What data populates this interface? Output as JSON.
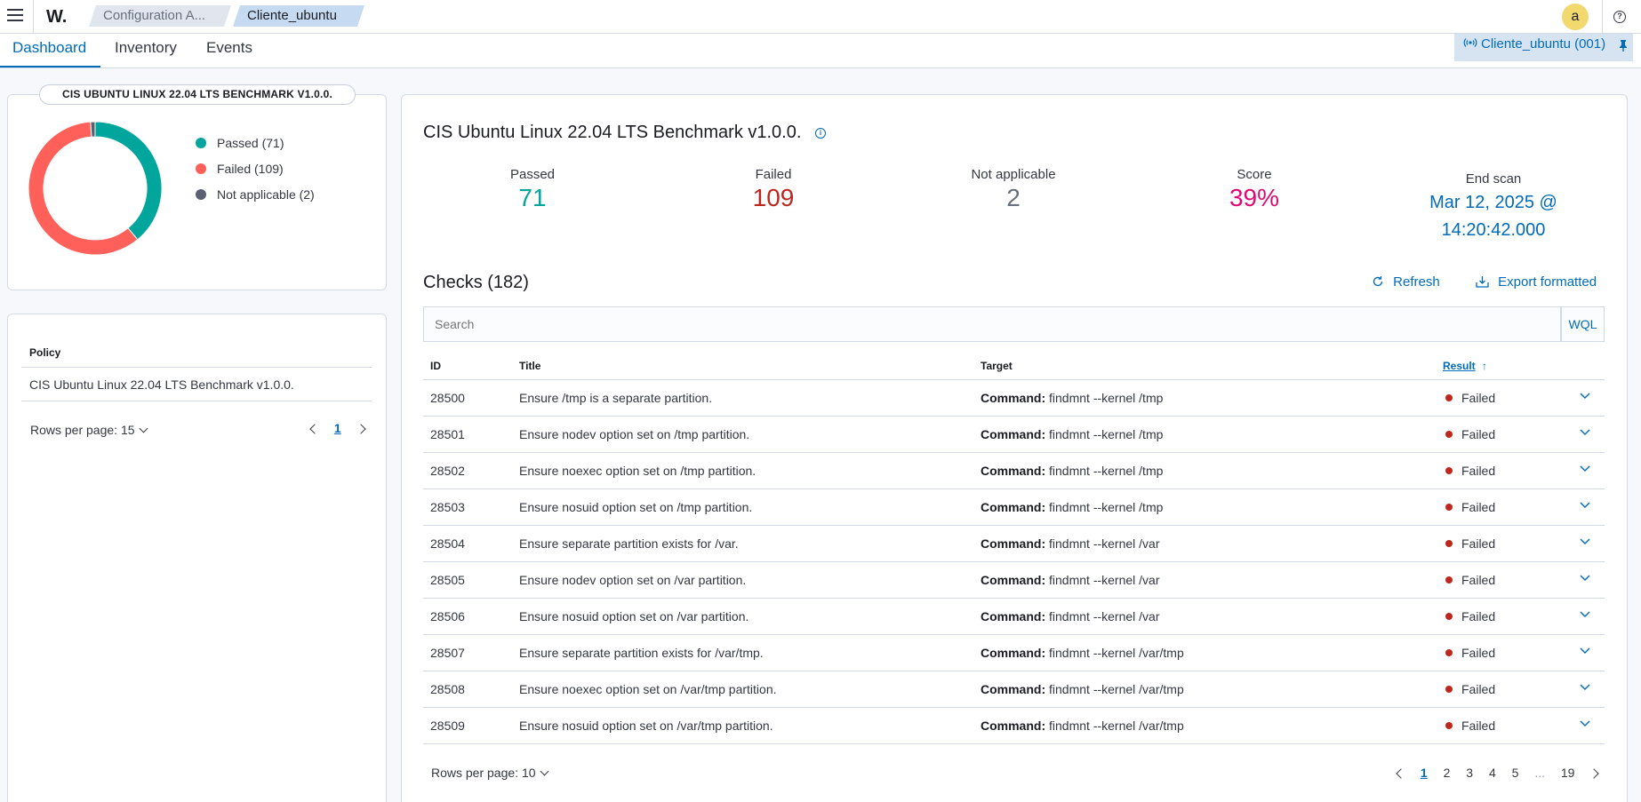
{
  "header": {
    "logo": "W.",
    "breadcrumbs": [
      "Configuration A...",
      "Cliente_ubuntu"
    ],
    "avatar": "a",
    "help": "?"
  },
  "tabs": [
    "Dashboard",
    "Inventory",
    "Events"
  ],
  "agent_pill": "Cliente_ubuntu (001)",
  "summary": {
    "badge": "CIS UBUNTU LINUX 22.04 LTS BENCHMARK V1.0.0.",
    "legend": [
      {
        "label": "Passed (71)",
        "color": "#00a69b"
      },
      {
        "label": "Failed (109)",
        "color": "#ff6059"
      },
      {
        "label": "Not applicable (2)",
        "color": "#5a6270"
      }
    ],
    "donut_values": {
      "passed": 71,
      "failed": 109,
      "not_applicable": 2
    }
  },
  "policy": {
    "header": "Policy",
    "row": "CIS Ubuntu Linux 22.04 LTS Benchmark v1.0.0.",
    "rows_per_page": "Rows per page: 15",
    "page": "1"
  },
  "main": {
    "title": "CIS Ubuntu Linux 22.04 LTS Benchmark v1.0.0.",
    "stats": {
      "passed_label": "Passed",
      "passed": "71",
      "failed_label": "Failed",
      "failed": "109",
      "na_label": "Not applicable",
      "na": "2",
      "score_label": "Score",
      "score": "39%",
      "end_label": "End scan",
      "end_date": "Mar 12, 2025 @",
      "end_time": "14:20:42.000"
    },
    "checks_title": "Checks (182)",
    "refresh": "Refresh",
    "export": "Export formatted",
    "search_placeholder": "Search",
    "wql": "WQL",
    "columns": {
      "id": "ID",
      "title": "Title",
      "target": "Target",
      "result": "Result"
    },
    "rows": [
      {
        "id": "28500",
        "title": "Ensure /tmp is a separate partition.",
        "target_label": "Command:",
        "target": "findmnt --kernel /tmp",
        "result": "Failed"
      },
      {
        "id": "28501",
        "title": "Ensure nodev option set on /tmp partition.",
        "target_label": "Command:",
        "target": "findmnt --kernel /tmp",
        "result": "Failed"
      },
      {
        "id": "28502",
        "title": "Ensure noexec option set on /tmp partition.",
        "target_label": "Command:",
        "target": "findmnt --kernel /tmp",
        "result": "Failed"
      },
      {
        "id": "28503",
        "title": "Ensure nosuid option set on /tmp partition.",
        "target_label": "Command:",
        "target": "findmnt --kernel /tmp",
        "result": "Failed"
      },
      {
        "id": "28504",
        "title": "Ensure separate partition exists for /var.",
        "target_label": "Command:",
        "target": "findmnt --kernel /var",
        "result": "Failed"
      },
      {
        "id": "28505",
        "title": "Ensure nodev option set on /var partition.",
        "target_label": "Command:",
        "target": "findmnt --kernel /var",
        "result": "Failed"
      },
      {
        "id": "28506",
        "title": "Ensure nosuid option set on /var partition.",
        "target_label": "Command:",
        "target": "findmnt --kernel /var",
        "result": "Failed"
      },
      {
        "id": "28507",
        "title": "Ensure separate partition exists for /var/tmp.",
        "target_label": "Command:",
        "target": "findmnt --kernel /var/tmp",
        "result": "Failed"
      },
      {
        "id": "28508",
        "title": "Ensure noexec option set on /var/tmp partition.",
        "target_label": "Command:",
        "target": "findmnt --kernel /var/tmp",
        "result": "Failed"
      },
      {
        "id": "28509",
        "title": "Ensure nosuid option set on /var/tmp partition.",
        "target_label": "Command:",
        "target": "findmnt --kernel /var/tmp",
        "result": "Failed"
      }
    ],
    "rows_per_page": "Rows per page: 10",
    "pages": [
      "1",
      "2",
      "3",
      "4",
      "5",
      "...",
      "19"
    ]
  },
  "colors": {
    "accent": "#006bb8",
    "passed": "#00a69b",
    "failed": "#bd271e",
    "score": "#dd0a73",
    "na": "#69707d"
  }
}
